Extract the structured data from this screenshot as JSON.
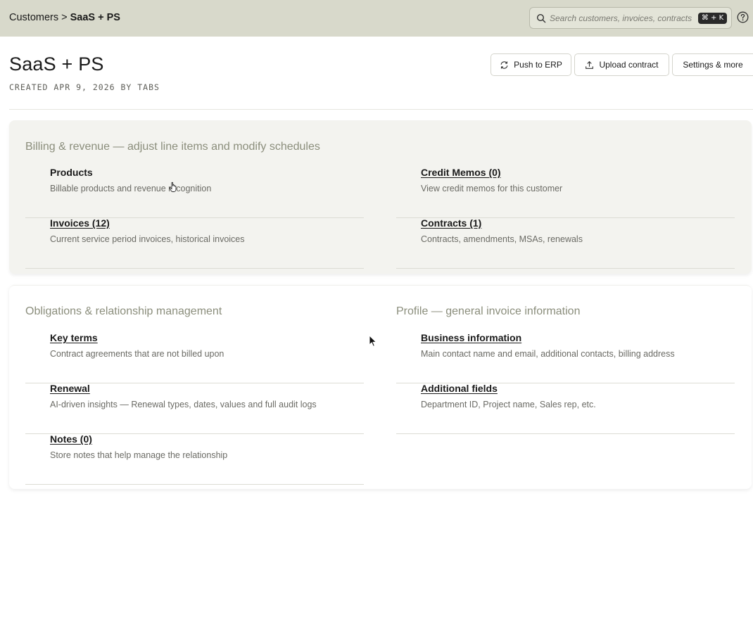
{
  "breadcrumb": {
    "parent": "Customers",
    "separator": ">",
    "current": "SaaS + PS"
  },
  "search": {
    "placeholder": "Search customers, invoices, contracts",
    "shortcut": "⌘ + K"
  },
  "icons": {
    "search": "search-icon",
    "help": "help-circle-icon",
    "sync": "refresh-icon",
    "upload": "upload-icon"
  },
  "header": {
    "title": "SaaS + PS",
    "created": "CREATED APR 9, 2026 BY TABS",
    "push_label": "Push to ERP",
    "upload_label": "Upload contract",
    "settings_label": "Settings & more"
  },
  "billing": {
    "title": "Billing & revenue — adjust line items and modify schedules",
    "items": [
      {
        "label": "Products",
        "desc": "Billable products and revenue recognition"
      },
      {
        "label": "Credit Memos (0)",
        "desc": "View credit memos for this customer"
      },
      {
        "label": "Invoices (12)",
        "desc": "Current service period invoices, historical invoices"
      },
      {
        "label": "Contracts (1)",
        "desc": "Contracts, amendments, MSAs, renewals"
      }
    ]
  },
  "obligations": {
    "title": "Obligations & relationship management",
    "items": [
      {
        "label": "Key terms",
        "desc": "Contract agreements that are not billed upon"
      },
      {
        "label": "Renewal",
        "desc": "AI-driven insights — Renewal types, dates, values and full audit logs"
      },
      {
        "label": "Notes (0)",
        "desc": "Store notes that help manage the relationship"
      }
    ]
  },
  "profile": {
    "title": "Profile — general invoice information",
    "items": [
      {
        "label": "Business information",
        "desc": "Main contact name and email, additional contacts, billing address"
      },
      {
        "label": "Additional fields",
        "desc": "Department ID, Project name, Sales rep, etc."
      }
    ]
  },
  "colors": {
    "topbar": "#d8d9cb",
    "section_title": "#8b8e7c",
    "card_bg": "#f3f3ef"
  }
}
